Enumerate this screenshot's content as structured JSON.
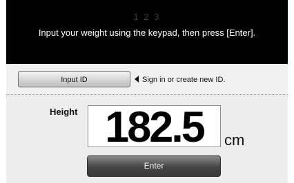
{
  "header": {
    "steps": "1 2 3",
    "instruction": "Input your weight using the keypad, then press [Enter]."
  },
  "id_row": {
    "input_id_label": "Input ID",
    "hint": "Sign in or create new ID.",
    "hint_icon": "left-triangle-arrow-icon"
  },
  "measurement": {
    "label": "Height",
    "value": "182.5",
    "unit": "cm"
  },
  "enter_label": "Enter",
  "colors": {
    "header_bg": "#000000",
    "panel_bg": "#ededed",
    "enter_bg": "#444444"
  }
}
